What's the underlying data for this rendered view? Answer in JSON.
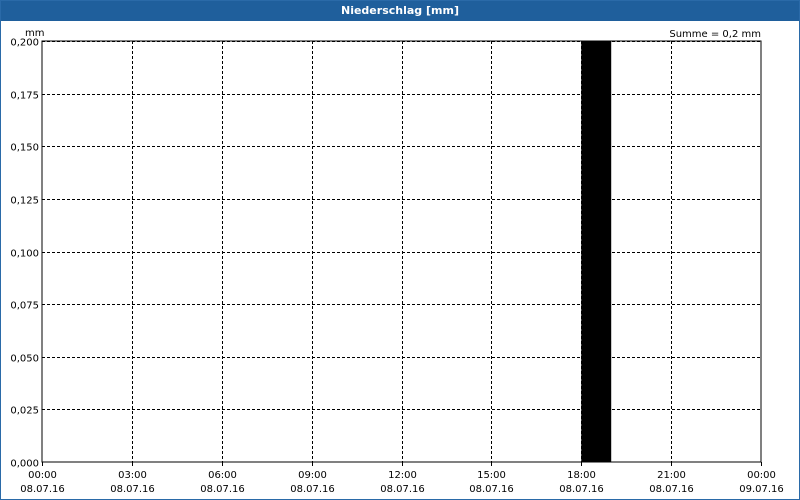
{
  "window": {
    "title": "Niederschlag [mm]"
  },
  "chart_data": {
    "type": "bar",
    "title": "Niederschlag [mm]",
    "ylabel": "mm",
    "annotation": "Summe = 0,2 mm",
    "ylim": [
      0,
      0.2
    ],
    "y_ticks": [
      "0,000",
      "0,025",
      "0,050",
      "0,075",
      "0,100",
      "0,125",
      "0,150",
      "0,175",
      "0,200"
    ],
    "x_range_hours": [
      0,
      24
    ],
    "x_ticks": [
      {
        "time": "00:00",
        "date": "08.07.16"
      },
      {
        "time": "03:00",
        "date": "08.07.16"
      },
      {
        "time": "06:00",
        "date": "08.07.16"
      },
      {
        "time": "09:00",
        "date": "08.07.16"
      },
      {
        "time": "12:00",
        "date": "08.07.16"
      },
      {
        "time": "15:00",
        "date": "08.07.16"
      },
      {
        "time": "18:00",
        "date": "08.07.16"
      },
      {
        "time": "21:00",
        "date": "08.07.16"
      },
      {
        "time": "00:00",
        "date": "09.07.16"
      }
    ],
    "bars": [
      {
        "start": "08.07.16 18:00",
        "end": "08.07.16 19:00",
        "value": 0.2
      }
    ],
    "grid": true,
    "bar_color": "#000000"
  }
}
